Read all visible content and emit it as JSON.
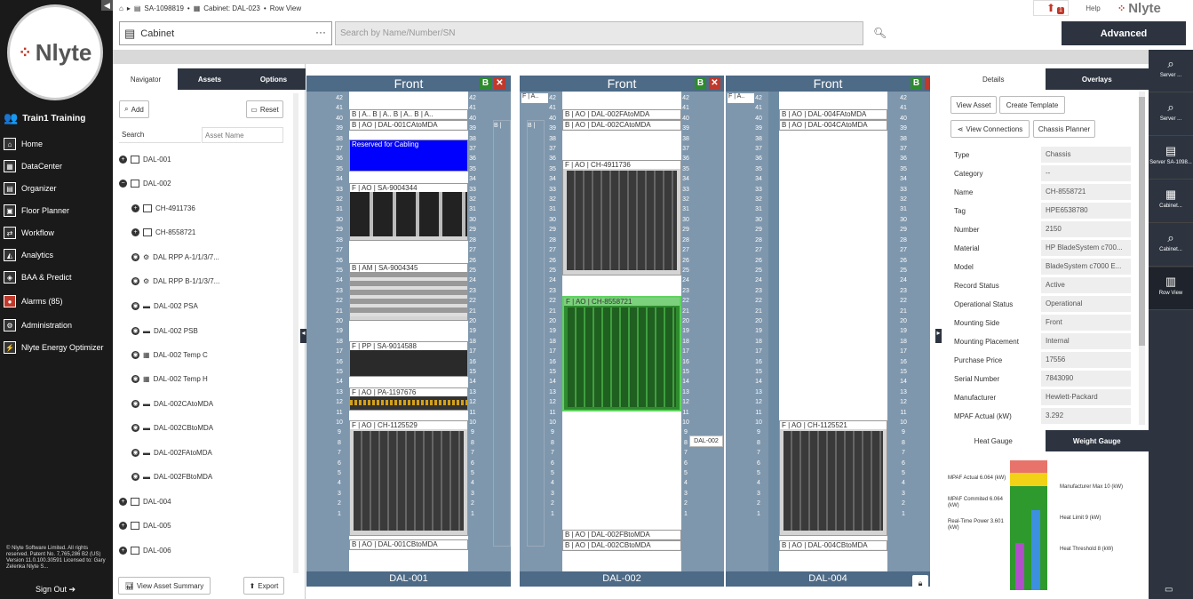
{
  "app": {
    "logo_text": "Nlyte",
    "user": "Train1 Training",
    "nav": [
      {
        "label": "Home",
        "icon": "home-icon"
      },
      {
        "label": "DataCenter",
        "icon": "datacenter-icon"
      },
      {
        "label": "Organizer",
        "icon": "organizer-icon"
      },
      {
        "label": "Floor Planner",
        "icon": "floor-planner-icon"
      },
      {
        "label": "Workflow",
        "icon": "workflow-icon"
      },
      {
        "label": "Analytics",
        "icon": "analytics-icon"
      },
      {
        "label": "BAA & Predict",
        "icon": "baa-icon"
      },
      {
        "label": "Alarms (85)",
        "icon": "alarms-icon"
      },
      {
        "label": "Administration",
        "icon": "administration-icon"
      },
      {
        "label": "Nlyte Energy Optimizer",
        "icon": "energy-icon"
      }
    ],
    "copyright": "© Nlyte Software Limited. All rights reserved. Patent No. 7,765,286 B2 (US) Version 11.0.100.30591 Licensed to: Gary Zelenka Nlyte S...",
    "sign_out": "Sign Out"
  },
  "header": {
    "breadcrumb": [
      "SA-1098819",
      "Cabinet: DAL-023",
      "Row View"
    ],
    "help": "Help",
    "brand": "Nlyte",
    "upload_badge": "1",
    "select_value": "Cabinet",
    "search_placeholder": "Search by Name/Number/SN",
    "advanced": "Advanced"
  },
  "navigator": {
    "tabs": [
      "Navigator",
      "Assets",
      "Options"
    ],
    "add": "Add",
    "reset": "Reset",
    "search_label": "Search",
    "asset_name_placeholder": "Asset Name",
    "tree": [
      "DAL-001",
      "DAL-002",
      "CH-4911736",
      "CH-8558721",
      "DAL RPP A-1/1/3/7...",
      "DAL RPP B-1/1/3/7...",
      "DAL-002 PSA",
      "DAL-002 PSB",
      "DAL-002 Temp C",
      "DAL-002 Temp H",
      "DAL-002CAtoMDA",
      "DAL-002CBtoMDA",
      "DAL-002FAtoMDA",
      "DAL-002FBtoMDA",
      "DAL-004",
      "DAL-005",
      "DAL-006"
    ],
    "summary": "View Asset Summary",
    "export": "Export"
  },
  "racks": [
    {
      "title": "Front",
      "footer": "DAL-001",
      "devices": [
        "B | A.. B | A.. B | A.. B | A..",
        "B | AO | DAL-001CAtoMDA",
        "Reserved for Cabling",
        "F | AO | SA-9004344",
        "B | AM | SA-9004345",
        "F | PP | SA-9014588",
        "F | AO | PA-1197676",
        "F | AO | CH-1125529",
        "B | AO | DAL-001CBtoMDA"
      ]
    },
    {
      "title": "Front",
      "footer": "DAL-002",
      "devices": [
        "F | A..",
        "B | AO | DAL-002FAtoMDA",
        "B | AO | DAL-002CAtoMDA",
        "F | AO | CH-4911736",
        "F | AO | CH-8558721",
        "B | AO | DAL-002FBtoMDA",
        "B | AO | DAL-002CBtoMDA"
      ]
    },
    {
      "title": "Front",
      "footer": "DAL-004",
      "devices": [
        "F | A..",
        "B | AO | DAL-004FAtoMDA",
        "B | AO | DAL-004CAtoMDA",
        "F | AO | CH-1125521",
        "B | AO | DAL-004CBtoMDA"
      ]
    }
  ],
  "rack_misc": {
    "tooltip": "DAL-002",
    "side_label": "B |",
    "side_label_short": "B |"
  },
  "details": {
    "tabs": [
      "Details",
      "Overlays"
    ],
    "buttons": [
      "View Asset",
      "Create Template",
      "View Connections",
      "Chassis Planner"
    ],
    "props": [
      {
        "k": "Type",
        "v": "Chassis"
      },
      {
        "k": "Category",
        "v": "--"
      },
      {
        "k": "Name",
        "v": "CH-8558721"
      },
      {
        "k": "Tag",
        "v": "HPE6538780"
      },
      {
        "k": "Number",
        "v": "2150"
      },
      {
        "k": "Material",
        "v": "HP BladeSystem c700..."
      },
      {
        "k": "Model",
        "v": "BladeSystem c7000 E..."
      },
      {
        "k": "Record Status",
        "v": "Active"
      },
      {
        "k": "Operational Status",
        "v": "Operational"
      },
      {
        "k": "Mounting Side",
        "v": "Front"
      },
      {
        "k": "Mounting Placement",
        "v": "Internal"
      },
      {
        "k": "Purchase Price",
        "v": "17556"
      },
      {
        "k": "Serial Number",
        "v": "7843090"
      },
      {
        "k": "Manufacturer",
        "v": "Hewlett-Packard"
      },
      {
        "k": "MPAF Actual (kW)",
        "v": "3.292"
      }
    ],
    "gauge_tabs": [
      "Heat Gauge",
      "Weight Gauge"
    ],
    "gauge_left": [
      "MPAF Actual 6.064 (kW)",
      "MPAF Commited 6.064 (kW)",
      "Real-Time Power 3.601 (kW)"
    ],
    "gauge_right": [
      "Manufacturer Max 10 (kW)",
      "Heat Limit 9 (kW)",
      "Heat Threshold 8 (kW)"
    ]
  },
  "rightstrip": [
    {
      "label": "Server ...",
      "icon": "search-icon"
    },
    {
      "label": "Server ...",
      "icon": "search-icon"
    },
    {
      "label": "Server SA-1098...",
      "icon": "server-icon"
    },
    {
      "label": "Cabinet...",
      "icon": "cabinet-icon"
    },
    {
      "label": "Cabinet...",
      "icon": "search-icon"
    },
    {
      "label": "Row View",
      "icon": "row-view-icon"
    }
  ]
}
